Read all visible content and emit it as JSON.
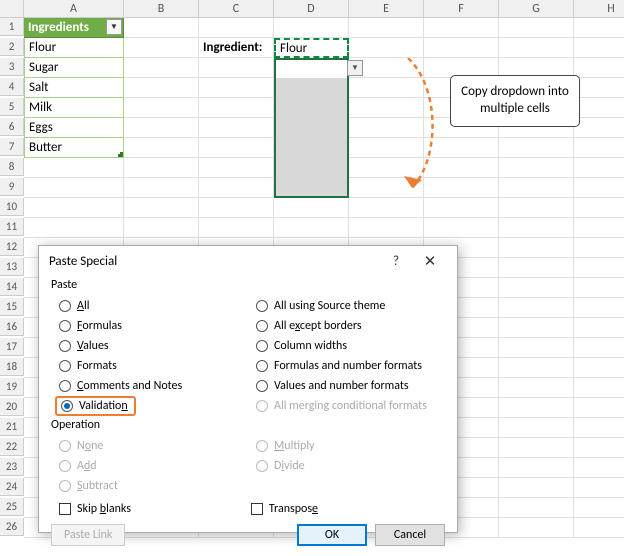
{
  "columns": [
    "A",
    "B",
    "C",
    "D",
    "E",
    "F",
    "G",
    "H"
  ],
  "rows_visible": 26,
  "table": {
    "header": "Ingredients",
    "items": [
      "Flour",
      "Sugar",
      "Salt",
      "Milk",
      "Eggs",
      "Butter"
    ]
  },
  "label_cell": "Ingredient:",
  "d2_value": "Flour",
  "callout": "Copy dropdown into multiple cells",
  "dialog": {
    "title": "Paste Special",
    "group_paste": "Paste",
    "group_operation": "Operation",
    "left_opts": [
      "All",
      "Formulas",
      "Values",
      "Formats",
      "Comments and Notes",
      "Validation"
    ],
    "left_u": [
      "A",
      "F",
      "V",
      "",
      "C",
      "n"
    ],
    "right_opts": [
      "All using Source theme",
      "All except borders",
      "Column widths",
      "Formulas and number formats",
      "Values and number formats",
      "All merging conditional formats"
    ],
    "right_u": [
      "",
      "x",
      "W",
      "",
      "",
      "g"
    ],
    "op_left": [
      "None",
      "Add",
      "Subtract"
    ],
    "op_left_u": [
      "o",
      "d",
      "S"
    ],
    "op_right": [
      "Multiply",
      "Divide"
    ],
    "op_right_u": [
      "M",
      "i"
    ],
    "skip": "Skip blanks",
    "transpose": "Transpose",
    "paste_link": "Paste Link",
    "ok": "OK",
    "cancel": "Cancel"
  }
}
